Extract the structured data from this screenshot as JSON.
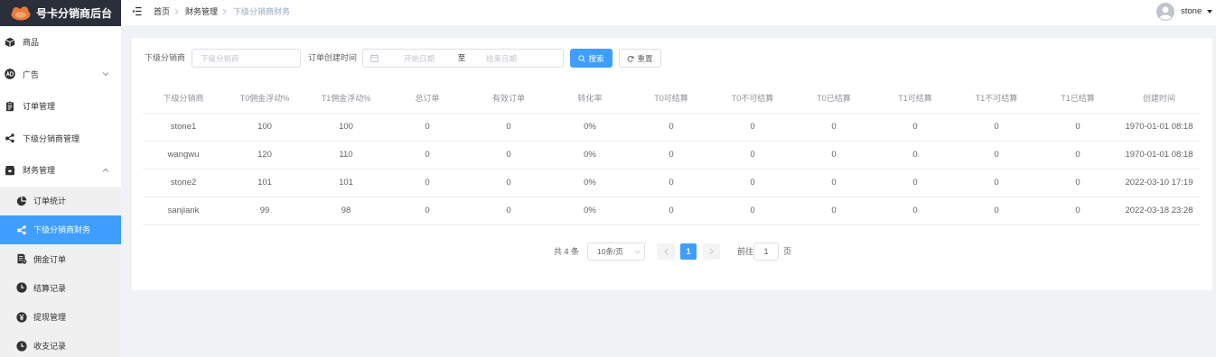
{
  "app": {
    "title": "号卡分销商后台"
  },
  "sidebar": {
    "items": [
      {
        "label": "商品",
        "icon": "cube-icon"
      },
      {
        "label": "广告",
        "icon": "ad-icon",
        "expandable": true,
        "expanded": false
      },
      {
        "label": "订单管理",
        "icon": "clipboard-icon"
      },
      {
        "label": "下级分销商管理",
        "icon": "share-nodes-icon"
      },
      {
        "label": "财务管理",
        "icon": "wallet-icon",
        "expandable": true,
        "expanded": true,
        "children": [
          {
            "label": "订单统计",
            "icon": "pie-chart-icon"
          },
          {
            "label": "下级分销商财务",
            "icon": "share-nodes-icon",
            "active": true
          },
          {
            "label": "佣金订单",
            "icon": "document-icon"
          },
          {
            "label": "结算记录",
            "icon": "clock-icon"
          },
          {
            "label": "提现管理",
            "icon": "yen-circle-icon"
          },
          {
            "label": "收支记录",
            "icon": "clock-icon"
          }
        ]
      }
    ]
  },
  "header": {
    "breadcrumb": [
      "首页",
      "财务管理",
      "下级分销商财务"
    ],
    "user": {
      "name": "stone"
    }
  },
  "filters": {
    "distributor": {
      "label": "下级分销商",
      "value": "",
      "placeholder": "下级分销商"
    },
    "created_time": {
      "label": "订单创建时间",
      "start_placeholder": "开始日期",
      "separator": "至",
      "end_placeholder": "结束日期"
    },
    "search_label": "搜索",
    "reset_label": "重置"
  },
  "table": {
    "columns": [
      "下级分销商",
      "T0佣金浮动%",
      "T1佣金浮动%",
      "总订单",
      "有效订单",
      "转化率",
      "T0可结算",
      "T0不可结算",
      "T0已结算",
      "T1可结算",
      "T1不可结算",
      "T1已结算",
      "创建时间"
    ],
    "rows": [
      [
        "stone1",
        "100",
        "100",
        "0",
        "0",
        "0%",
        "0",
        "0",
        "0",
        "0",
        "0",
        "0",
        "1970-01-01 08:18"
      ],
      [
        "wangwu",
        "120",
        "110",
        "0",
        "0",
        "0%",
        "0",
        "0",
        "0",
        "0",
        "0",
        "0",
        "1970-01-01 08:18"
      ],
      [
        "stone2",
        "101",
        "101",
        "0",
        "0",
        "0%",
        "0",
        "0",
        "0",
        "0",
        "0",
        "0",
        "2022-03-10 17:19"
      ],
      [
        "sanjiank",
        "99",
        "98",
        "0",
        "0",
        "0%",
        "0",
        "0",
        "0",
        "0",
        "0",
        "0",
        "2022-03-18 23:28"
      ]
    ]
  },
  "pagination": {
    "total_text": "共 4 条",
    "page_size": "10条/页",
    "current_page": "1",
    "goto_label": "前往",
    "goto_value": "1",
    "page_suffix": "页"
  },
  "colors": {
    "primary": "#409eff",
    "logo_bar": "#2b2f3a",
    "page_bg": "#f0f2f5",
    "submenu_bg": "#f0f0f0"
  }
}
